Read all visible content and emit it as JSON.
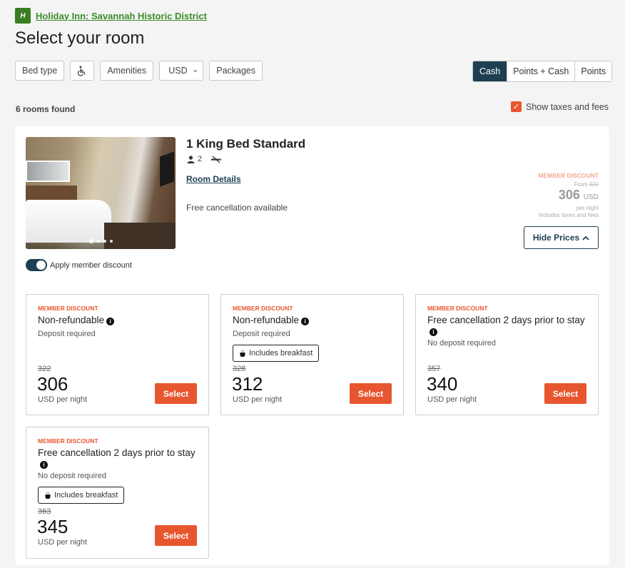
{
  "header": {
    "logo_glyph": "H",
    "hotel_link": "Holiday Inn: Savannah Historic District",
    "title": "Select your room"
  },
  "filters": {
    "bed_type": "Bed type",
    "accessibility_icon": "wheelchair-icon",
    "amenities": "Amenities",
    "currency": "USD",
    "packages": "Packages"
  },
  "payment_modes": [
    {
      "label": "Cash",
      "active": true
    },
    {
      "label": "Points + Cash",
      "active": false
    },
    {
      "label": "Points",
      "active": false
    }
  ],
  "results": {
    "count_text": "6 rooms found",
    "show_taxes_label": "Show taxes and fees",
    "show_taxes_checked": true
  },
  "room": {
    "name": "1 King Bed Standard",
    "guests": "2",
    "smoking": "non-smoking",
    "details_link": "Room Details",
    "cancellation": "Free cancellation available",
    "photo_count": 4,
    "photo_active": 1,
    "summary": {
      "label": "MEMBER DISCOUNT",
      "from_text": "From",
      "from_original": "322",
      "price": "306",
      "currency": "USD",
      "per_night": "per night",
      "taxes_note": "Includes taxes and fees"
    },
    "hide_prices_label": "Hide Prices",
    "member_discount_label": "Apply member discount",
    "member_discount_on": true
  },
  "rates": [
    {
      "label": "MEMBER DISCOUNT",
      "title": "Non-refundable",
      "deposit": "Deposit required",
      "badge": "",
      "original": "322",
      "price": "306",
      "per": "USD per night",
      "select": "Select"
    },
    {
      "label": "MEMBER DISCOUNT",
      "title": "Non-refundable",
      "deposit": "Deposit required",
      "badge": "Includes breakfast",
      "original": "328",
      "price": "312",
      "per": "USD per night",
      "select": "Select"
    },
    {
      "label": "MEMBER DISCOUNT",
      "title": "Free cancellation 2 days prior to stay",
      "deposit": "No deposit required",
      "badge": "",
      "original": "357",
      "price": "340",
      "per": "USD per night",
      "select": "Select"
    },
    {
      "label": "MEMBER DISCOUNT",
      "title": "Free cancellation 2 days prior to stay",
      "deposit": "No deposit required",
      "badge": "Includes breakfast",
      "original": "363",
      "price": "345",
      "per": "USD per night",
      "select": "Select"
    }
  ],
  "colors": {
    "brand_green": "#3a7d23",
    "accent_orange": "#e8562f",
    "navy": "#1d3f52",
    "background": "#f4f4f4"
  }
}
